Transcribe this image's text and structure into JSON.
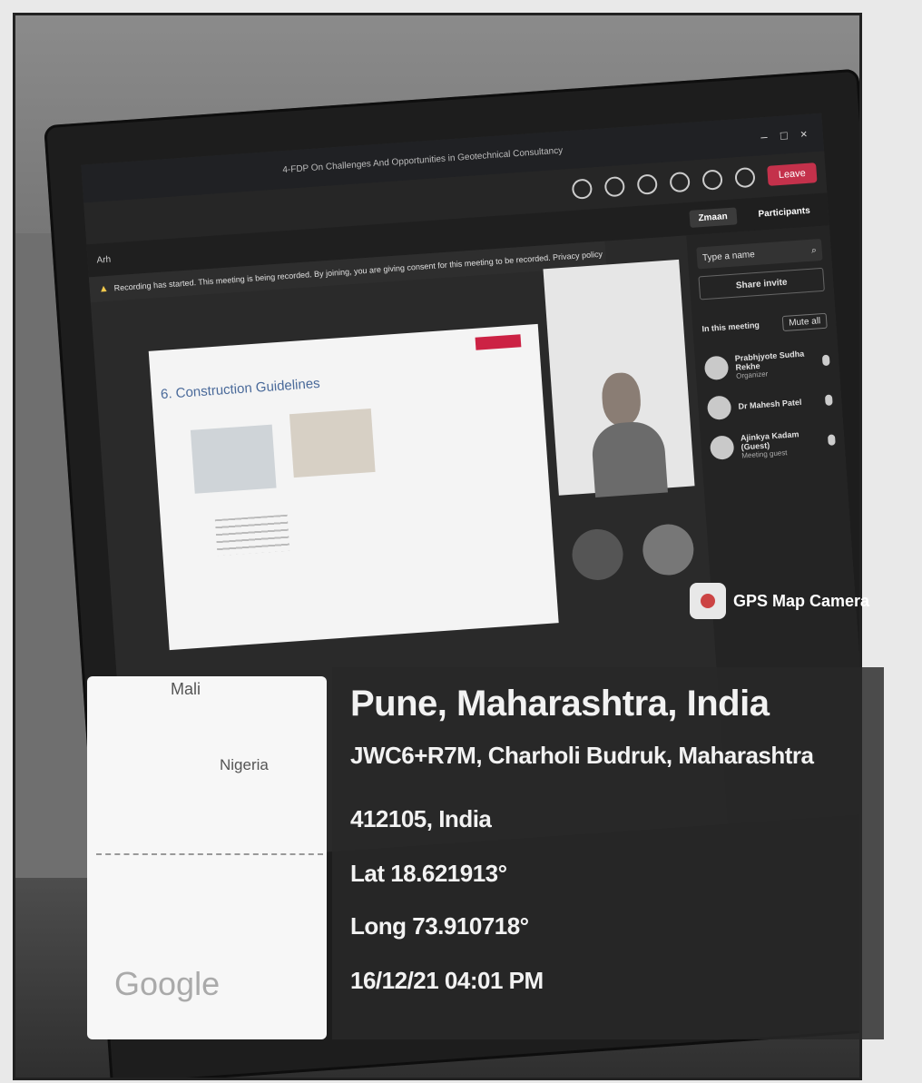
{
  "window": {
    "title": "4-FDP On Challenges And Opportunities in Geotechnical Consultancy",
    "leave_label": "Leave",
    "minimize": "–",
    "maximize": "□",
    "close": "×"
  },
  "subbar": {
    "left_text": "Arh",
    "chat_tab": "Zmaan",
    "participants_tab": "Participants"
  },
  "banner": {
    "text": "Recording has started. This meeting is being recorded. By joining, you are giving consent for this meeting to be recorded. Privacy policy"
  },
  "slide": {
    "title": "6. Construction Guidelines"
  },
  "participants": {
    "search_placeholder": "Type a name",
    "share_invite": "Share invite",
    "in_meeting_label": "In this meeting",
    "mute_all": "Mute all",
    "people": [
      {
        "name": "Prabhjyote Sudha Rekhe",
        "role": "Organizer"
      },
      {
        "name": "Dr Mahesh Patel",
        "role": ""
      },
      {
        "name": "Ajinkya Kadam (Guest)",
        "role": "Meeting guest"
      }
    ]
  },
  "map": {
    "country_1": "Mali",
    "country_2": "Nigeria",
    "logo": "Google"
  },
  "gps": {
    "app_label": "GPS Map Camera",
    "city": "Pune, Maharashtra, India",
    "address_line_1": "JWC6+R7M, Charholi Budruk, Maharashtra",
    "address_line_2": "412105, India",
    "lat": "Lat 18.621913°",
    "long": "Long 73.910718°",
    "datetime": "16/12/21 04:01 PM"
  }
}
